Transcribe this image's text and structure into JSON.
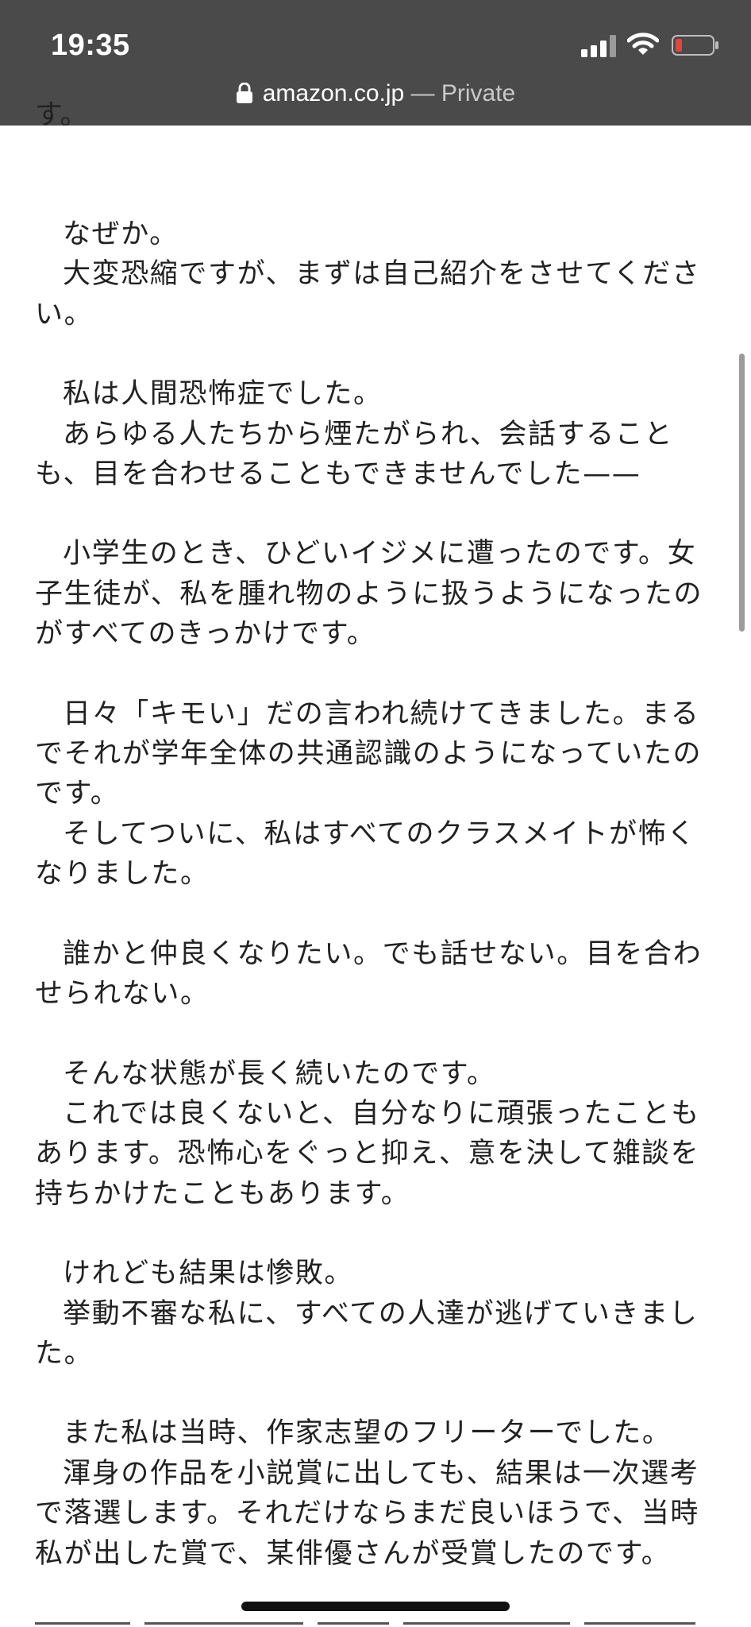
{
  "status_bar": {
    "time": "19:35",
    "icons": [
      "cellular-signal-icon",
      "wifi-icon",
      "battery-icon"
    ],
    "battery_color": "#e0463c"
  },
  "address_bar": {
    "domain": "amazon.co.jp",
    "separator": " — ",
    "mode": "Private"
  },
  "article": {
    "cut_top": "す。",
    "paragraphs": [
      {
        "lines": [
          ""
        ]
      },
      {
        "lines": [
          "なぜか。",
          "大変恐縮ですが、まずは自己紹介をさせてください。"
        ]
      },
      {
        "lines": [
          "私は人間恐怖症でした。",
          "あらゆる人たちから煙たがられ、会話することも、目を合わせることもできませんでした——"
        ]
      },
      {
        "lines": [
          "小学生のとき、ひどいイジメに遭ったのです。女子生徒が、私を腫れ物のように扱うようになったのがすべてのきっかけです。"
        ]
      },
      {
        "lines": [
          "日々「キモい」だの言われ続けてきました。まるでそれが学年全体の共通認識のようになっていたのです。",
          "そしてついに、私はすべてのクラスメイトが怖くなりました。"
        ]
      },
      {
        "lines": [
          "誰かと仲良くなりたい。でも話せない。目を合わせられない。"
        ]
      },
      {
        "lines": [
          "そんな状態が長く続いたのです。",
          "これでは良くないと、自分なりに頑張ったこともあります。恐怖心をぐっと抑え、意を決して雑談を持ちかけたこともあります。"
        ]
      },
      {
        "lines": [
          "けれども結果は惨敗。",
          "挙動不審な私に、すべての人達が逃げていきました。"
        ]
      },
      {
        "lines": [
          "また私は当時、作家志望のフリーターでした。",
          "渾身の作品を小説賞に出しても、結果は一次選考で落選します。それだけならまだ良いほうで、当時私が出した賞で、某俳優さんが受賞したのです。"
        ]
      }
    ]
  }
}
